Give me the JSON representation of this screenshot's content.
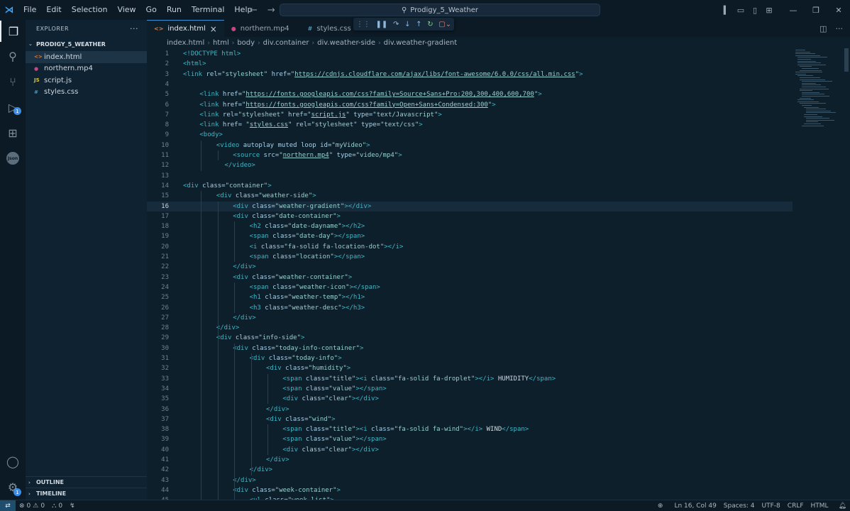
{
  "titlebar": {
    "menu": [
      "File",
      "Edit",
      "Selection",
      "View",
      "Go",
      "Run",
      "Terminal",
      "Help"
    ],
    "search_text": "Prodigy_5_Weather"
  },
  "sidebar": {
    "header": "EXPLORER",
    "folder": "PRODIGY_5_WEATHER",
    "files": [
      {
        "name": "index.html",
        "icon": "<>",
        "color": "#e37933"
      },
      {
        "name": "northern.mp4",
        "icon": "●",
        "color": "#c74585"
      },
      {
        "name": "script.js",
        "icon": "JS",
        "color": "#d8c948"
      },
      {
        "name": "styles.css",
        "icon": "#",
        "color": "#519aba"
      }
    ],
    "outline_label": "OUTLINE",
    "timeline_label": "TIMELINE"
  },
  "tabs": [
    {
      "label": "index.html",
      "icon": "<>",
      "color": "#e37933",
      "active": true,
      "close": "×"
    },
    {
      "label": "northern.mp4",
      "icon": "●",
      "color": "#c74585",
      "active": false
    },
    {
      "label": "styles.css",
      "icon": "#",
      "color": "#519aba",
      "active": false
    }
  ],
  "breadcrumb": [
    "index.html",
    "html",
    "body",
    "div.container",
    "div.weather-side",
    "div.weather-gradient"
  ],
  "editor": {
    "current_line": 16,
    "lines": [
      {
        "n": "1",
        "i": 0,
        "t": [
          [
            "tag",
            "<!DOCTYPE html>"
          ]
        ]
      },
      {
        "n": "2",
        "i": 0,
        "t": [
          [
            "tag",
            "<html>"
          ]
        ]
      },
      {
        "n": "3",
        "i": 0,
        "t": [
          [
            "tag",
            "<link "
          ],
          [
            "attr",
            "rel="
          ],
          [
            "str",
            "\"stylesheet\""
          ],
          [
            "attr",
            " href="
          ],
          [
            "str",
            "\""
          ],
          [
            "url",
            "https://cdnjs.cloudflare.com/ajax/libs/font-awesome/6.0.0/css/all.min.css"
          ],
          [
            "str",
            "\""
          ],
          [
            "tag",
            ">"
          ]
        ]
      },
      {
        "n": "4",
        "i": 0,
        "t": []
      },
      {
        "n": "5",
        "i": 1,
        "t": [
          [
            "tag",
            "<link "
          ],
          [
            "attr",
            "href="
          ],
          [
            "str",
            "\""
          ],
          [
            "url",
            "https://fonts.googleapis.com/css?family=Source+Sans+Pro:200,300,400,600,700"
          ],
          [
            "str",
            "\""
          ],
          [
            "tag",
            ">"
          ]
        ]
      },
      {
        "n": "6",
        "i": 1,
        "t": [
          [
            "tag",
            "<link "
          ],
          [
            "attr",
            "href="
          ],
          [
            "str",
            "\""
          ],
          [
            "url",
            "https://fonts.googleapis.com/css?family=Open+Sans+Condensed:300"
          ],
          [
            "str",
            "\""
          ],
          [
            "tag",
            ">"
          ]
        ]
      },
      {
        "n": "7",
        "i": 1,
        "t": [
          [
            "tag",
            "<link "
          ],
          [
            "attr",
            "rel="
          ],
          [
            "str",
            "\"stylesheet\""
          ],
          [
            "attr",
            " href="
          ],
          [
            "str",
            "\""
          ],
          [
            "url",
            "script.js"
          ],
          [
            "str",
            "\""
          ],
          [
            "attr",
            " type="
          ],
          [
            "str",
            "\"text/Javascript\""
          ],
          [
            "tag",
            ">"
          ]
        ]
      },
      {
        "n": "8",
        "i": 1,
        "t": [
          [
            "tag",
            "<link "
          ],
          [
            "attr",
            "href= "
          ],
          [
            "str",
            "\""
          ],
          [
            "url",
            "styles.css"
          ],
          [
            "str",
            "\""
          ],
          [
            "attr",
            " rel="
          ],
          [
            "str",
            "\"stylesheet\""
          ],
          [
            "attr",
            " type="
          ],
          [
            "str",
            "\"text/css\""
          ],
          [
            "tag",
            ">"
          ]
        ]
      },
      {
        "n": "9",
        "i": 1,
        "t": [
          [
            "tag",
            "<body>"
          ]
        ]
      },
      {
        "n": "10",
        "i": 2,
        "t": [
          [
            "tag",
            "<video "
          ],
          [
            "attr",
            "autoplay muted loop id="
          ],
          [
            "str",
            "\"myVideo\""
          ],
          [
            "tag",
            ">"
          ]
        ]
      },
      {
        "n": "11",
        "i": 3,
        "t": [
          [
            "tag",
            "<source "
          ],
          [
            "attr",
            "src="
          ],
          [
            "str",
            "\""
          ],
          [
            "url",
            "northern.mp4"
          ],
          [
            "str",
            "\""
          ],
          [
            "attr",
            " type="
          ],
          [
            "str",
            "\"video/mp4\""
          ],
          [
            "tag",
            ">"
          ]
        ]
      },
      {
        "n": "12",
        "i": 2.5,
        "t": [
          [
            "tag",
            "</video>"
          ]
        ]
      },
      {
        "n": "13",
        "i": 0,
        "t": []
      },
      {
        "n": "14",
        "i": 0,
        "t": [
          [
            "tag",
            "<div "
          ],
          [
            "attr",
            "class="
          ],
          [
            "str",
            "\"container\""
          ],
          [
            "tag",
            ">"
          ]
        ]
      },
      {
        "n": "15",
        "i": 2,
        "t": [
          [
            "tag",
            "<div "
          ],
          [
            "attr",
            "class="
          ],
          [
            "str",
            "\"weather-side\""
          ],
          [
            "tag",
            ">"
          ]
        ]
      },
      {
        "n": "16",
        "i": 3,
        "t": [
          [
            "tag",
            "<div "
          ],
          [
            "attr",
            "class="
          ],
          [
            "str",
            "\"weather-gradient\""
          ],
          [
            "tag",
            "></div>"
          ]
        ]
      },
      {
        "n": "17",
        "i": 3,
        "t": [
          [
            "tag",
            "<div "
          ],
          [
            "attr",
            "class="
          ],
          [
            "str",
            "\"date-container\""
          ],
          [
            "tag",
            ">"
          ]
        ]
      },
      {
        "n": "18",
        "i": 4,
        "t": [
          [
            "tag",
            "<h2 "
          ],
          [
            "attr",
            "class="
          ],
          [
            "str",
            "\"date-dayname\""
          ],
          [
            "tag",
            "></h2>"
          ]
        ]
      },
      {
        "n": "19",
        "i": 4,
        "t": [
          [
            "tag",
            "<span "
          ],
          [
            "attr",
            "class="
          ],
          [
            "str",
            "\"date-day\""
          ],
          [
            "tag",
            "></span>"
          ]
        ]
      },
      {
        "n": "20",
        "i": 4,
        "t": [
          [
            "tag",
            "<i "
          ],
          [
            "attr",
            "class="
          ],
          [
            "str",
            "\"fa-solid fa-location-dot\""
          ],
          [
            "tag",
            "></i>"
          ]
        ]
      },
      {
        "n": "21",
        "i": 4,
        "t": [
          [
            "tag",
            "<span "
          ],
          [
            "attr",
            "class="
          ],
          [
            "str",
            "\"location\""
          ],
          [
            "tag",
            "></span>"
          ]
        ]
      },
      {
        "n": "22",
        "i": 3,
        "t": [
          [
            "tag",
            "</div>"
          ]
        ]
      },
      {
        "n": "23",
        "i": 3,
        "t": [
          [
            "tag",
            "<div "
          ],
          [
            "attr",
            "class="
          ],
          [
            "str",
            "\"weather-container\""
          ],
          [
            "tag",
            ">"
          ]
        ]
      },
      {
        "n": "24",
        "i": 4,
        "t": [
          [
            "tag",
            "<span "
          ],
          [
            "attr",
            "class="
          ],
          [
            "str",
            "\"weather-icon\""
          ],
          [
            "tag",
            "></span>"
          ]
        ]
      },
      {
        "n": "25",
        "i": 4,
        "t": [
          [
            "tag",
            "<h1 "
          ],
          [
            "attr",
            "class="
          ],
          [
            "str",
            "\"weather-temp\""
          ],
          [
            "tag",
            "></h1>"
          ]
        ]
      },
      {
        "n": "26",
        "i": 4,
        "t": [
          [
            "tag",
            "<h3 "
          ],
          [
            "attr",
            "class="
          ],
          [
            "str",
            "\"weather-desc\""
          ],
          [
            "tag",
            "></h3>"
          ]
        ]
      },
      {
        "n": "27",
        "i": 3,
        "t": [
          [
            "tag",
            "</div>"
          ]
        ]
      },
      {
        "n": "28",
        "i": 2,
        "t": [
          [
            "tag",
            "</div>"
          ]
        ]
      },
      {
        "n": "29",
        "i": 2,
        "t": [
          [
            "tag",
            "<div "
          ],
          [
            "attr",
            "class="
          ],
          [
            "str",
            "\"info-side\""
          ],
          [
            "tag",
            ">"
          ]
        ]
      },
      {
        "n": "30",
        "i": 3,
        "t": [
          [
            "tag",
            "<div "
          ],
          [
            "attr",
            "class="
          ],
          [
            "str",
            "\"today-info-container\""
          ],
          [
            "tag",
            ">"
          ]
        ]
      },
      {
        "n": "31",
        "i": 4,
        "t": [
          [
            "tag",
            "<div "
          ],
          [
            "attr",
            "class="
          ],
          [
            "str",
            "\"today-info\""
          ],
          [
            "tag",
            ">"
          ]
        ]
      },
      {
        "n": "32",
        "i": 5,
        "t": [
          [
            "tag",
            "<div "
          ],
          [
            "attr",
            "class="
          ],
          [
            "str",
            "\"humidity\""
          ],
          [
            "tag",
            ">"
          ]
        ]
      },
      {
        "n": "33",
        "i": 6,
        "t": [
          [
            "tag",
            "<span "
          ],
          [
            "attr",
            "class="
          ],
          [
            "str",
            "\"title\""
          ],
          [
            "tag",
            "><i "
          ],
          [
            "attr",
            "class="
          ],
          [
            "str",
            "\"fa-solid fa-droplet\""
          ],
          [
            "tag",
            "></i>"
          ],
          [
            "text",
            " HUMIDITY"
          ],
          [
            "tag",
            "</span>"
          ]
        ]
      },
      {
        "n": "34",
        "i": 6,
        "t": [
          [
            "tag",
            "<span "
          ],
          [
            "attr",
            "class="
          ],
          [
            "str",
            "\"value\""
          ],
          [
            "tag",
            "></span>"
          ]
        ]
      },
      {
        "n": "35",
        "i": 6,
        "t": [
          [
            "tag",
            "<div "
          ],
          [
            "attr",
            "class="
          ],
          [
            "str",
            "\"clear\""
          ],
          [
            "tag",
            "></div>"
          ]
        ]
      },
      {
        "n": "36",
        "i": 5,
        "t": [
          [
            "tag",
            "</div>"
          ]
        ]
      },
      {
        "n": "37",
        "i": 5,
        "t": [
          [
            "tag",
            "<div "
          ],
          [
            "attr",
            "class="
          ],
          [
            "str",
            "\"wind\""
          ],
          [
            "tag",
            ">"
          ]
        ]
      },
      {
        "n": "38",
        "i": 6,
        "t": [
          [
            "tag",
            "<span "
          ],
          [
            "attr",
            "class="
          ],
          [
            "str",
            "\"title\""
          ],
          [
            "tag",
            "><i "
          ],
          [
            "attr",
            "class="
          ],
          [
            "str",
            "\"fa-solid fa-wind\""
          ],
          [
            "tag",
            "></i>"
          ],
          [
            "text",
            " WIND"
          ],
          [
            "tag",
            "</span>"
          ]
        ]
      },
      {
        "n": "39",
        "i": 6,
        "t": [
          [
            "tag",
            "<span "
          ],
          [
            "attr",
            "class="
          ],
          [
            "str",
            "\"value\""
          ],
          [
            "tag",
            "></span>"
          ]
        ]
      },
      {
        "n": "40",
        "i": 6,
        "t": [
          [
            "tag",
            "<div "
          ],
          [
            "attr",
            "class="
          ],
          [
            "str",
            "\"clear\""
          ],
          [
            "tag",
            "></div>"
          ]
        ]
      },
      {
        "n": "41",
        "i": 5,
        "t": [
          [
            "tag",
            "</div>"
          ]
        ]
      },
      {
        "n": "42",
        "i": 4,
        "t": [
          [
            "tag",
            "</div>"
          ]
        ]
      },
      {
        "n": "43",
        "i": 3,
        "t": [
          [
            "tag",
            "</div>"
          ]
        ]
      },
      {
        "n": "44",
        "i": 3,
        "t": [
          [
            "tag",
            "<div "
          ],
          [
            "attr",
            "class="
          ],
          [
            "str",
            "\"week-container\""
          ],
          [
            "tag",
            ">"
          ]
        ]
      },
      {
        "n": "45",
        "i": 4,
        "t": [
          [
            "tag",
            "<ul "
          ],
          [
            "attr",
            "class="
          ],
          [
            "str",
            "\"week-list\""
          ],
          [
            "tag",
            ">"
          ]
        ]
      }
    ]
  },
  "statusbar": {
    "errors": "0",
    "warnings": "0",
    "ports": "0",
    "position": "Ln 16, Col 49",
    "spaces": "Spaces: 4",
    "encoding": "UTF-8",
    "eol": "CRLF",
    "language": "HTML"
  },
  "activity_badges": {
    "run": "1"
  },
  "icons": {
    "json_label": "Json"
  }
}
